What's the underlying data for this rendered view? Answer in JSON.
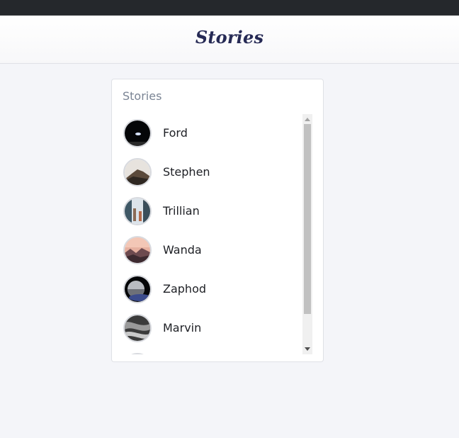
{
  "header": {
    "title": "Stories"
  },
  "stories_panel": {
    "title": "Stories",
    "items": [
      {
        "name": "Ford",
        "icon": "space-night-thumbnail"
      },
      {
        "name": "Stephen",
        "icon": "mountain-thumbnail"
      },
      {
        "name": "Trillian",
        "icon": "city-street-thumbnail"
      },
      {
        "name": "Wanda",
        "icon": "sunset-landscape-thumbnail"
      },
      {
        "name": "Zaphod",
        "icon": "planet-thumbnail"
      },
      {
        "name": "Marvin",
        "icon": "rock-texture-thumbnail"
      },
      {
        "name": "",
        "icon": "partial-thumbnail"
      }
    ]
  },
  "colors": {
    "title": "#262a55",
    "background": "#f4f5f9",
    "topbar": "#25282c"
  }
}
